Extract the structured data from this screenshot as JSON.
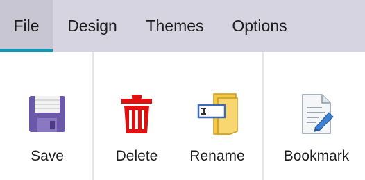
{
  "tabs": [
    {
      "label": "File",
      "active": true
    },
    {
      "label": "Design",
      "active": false
    },
    {
      "label": "Themes",
      "active": false
    },
    {
      "label": "Options",
      "active": false
    }
  ],
  "ribbon": {
    "save_label": "Save",
    "delete_label": "Delete",
    "rename_label": "Rename",
    "bookmark_label": "Bookmark"
  },
  "icons": {
    "save": "floppy-disk-icon",
    "delete": "trash-can-icon",
    "rename": "rename-folder-icon",
    "bookmark": "bookmark-document-icon"
  },
  "colors": {
    "tab_bar": "#d6d4e0",
    "active_underline": "#1a96b4",
    "delete_red": "#e01010",
    "save_purple": "#6b58a8"
  }
}
